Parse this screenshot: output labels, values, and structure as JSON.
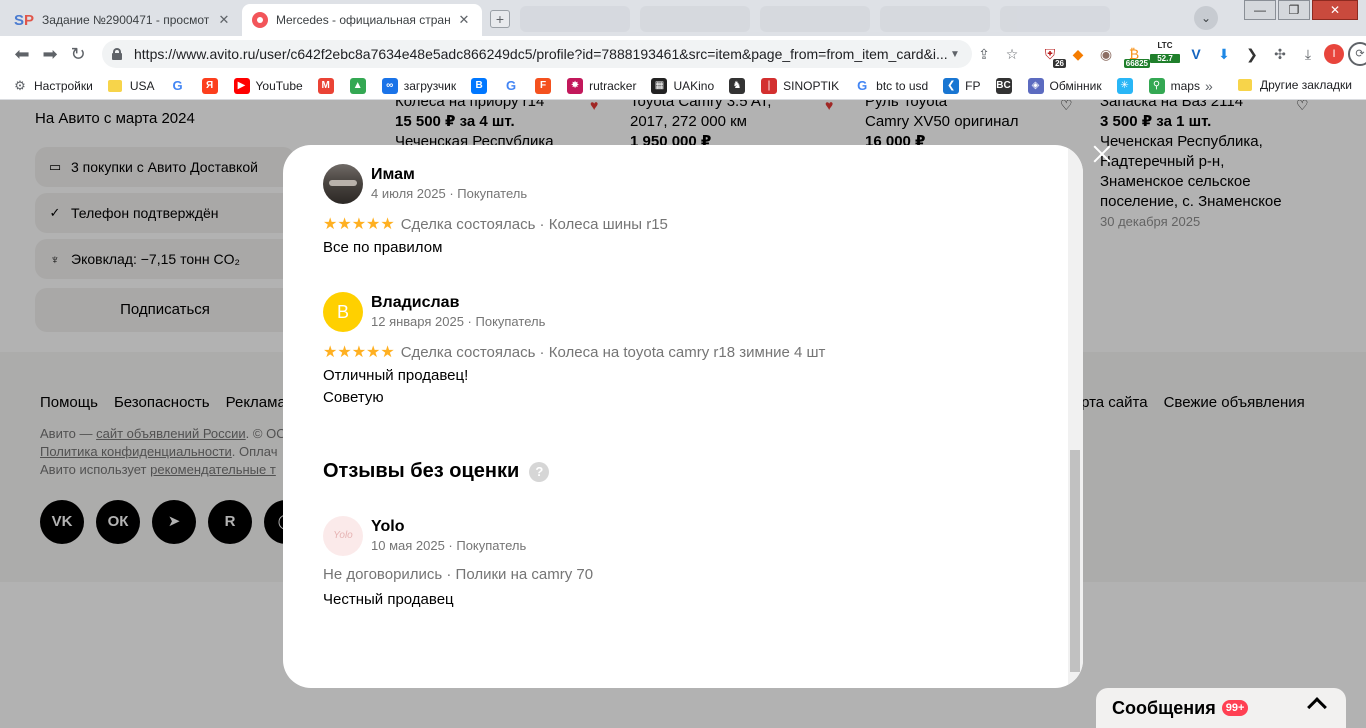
{
  "browser": {
    "tabs": [
      {
        "title": "Задание №2900471 - просмотр з",
        "favicon": "sp-icon"
      },
      {
        "title": "Mercedes - официальная страни",
        "favicon": "avito-icon"
      }
    ],
    "new_tab_label": "+",
    "profile_dropdown": "⌄",
    "window_controls": {
      "minimize": "—",
      "maximize": "❐",
      "close": "✕"
    },
    "url": "https://www.avito.ru/user/c642f2ebc8a7634e48e5adc866249dc5/profile?id=7888193461&src=item&page_from=from_item_card&i...",
    "extensions": {
      "badge_26": "26",
      "ltc_label": "LTC",
      "ltc_value": "52.7",
      "btc_value": "66825",
      "avatar_letter": "I"
    },
    "bookmarks": [
      {
        "label": "Настройки",
        "icon": "gear-icon",
        "color": "#5f6368"
      },
      {
        "label": "USA",
        "icon": "folder-icon",
        "color": "#f7d44a"
      },
      {
        "label": "",
        "icon": "google-icon",
        "color": "#4285f4"
      },
      {
        "label": "",
        "icon": "yandex-icon",
        "color": "#fc3f1d"
      },
      {
        "label": "YouTube",
        "icon": "youtube-icon",
        "color": "#ff0000"
      },
      {
        "label": "",
        "icon": "gmail-icon",
        "color": "#ea4335"
      },
      {
        "label": "",
        "icon": "drive-icon",
        "color": "#34a853"
      },
      {
        "label": "загрузчик",
        "icon": "loader-icon",
        "color": "#1a73e8"
      },
      {
        "label": "",
        "icon": "vk-icon",
        "color": "#0077ff"
      },
      {
        "label": "",
        "icon": "translate-icon",
        "color": "#4285f4"
      },
      {
        "label": "",
        "icon": "f-icon",
        "color": "#f4511e"
      },
      {
        "label": "rutracker",
        "icon": "rutracker-icon",
        "color": "#c2185b"
      },
      {
        "label": "UAKino",
        "icon": "uakino-icon",
        "color": "#222222"
      },
      {
        "label": "",
        "icon": "chess-icon",
        "color": "#333333"
      },
      {
        "label": "SINOPTIK",
        "icon": "thermometer-icon",
        "color": "#d32f2f"
      },
      {
        "label": "btc to usd",
        "icon": "google-icon",
        "color": "#4285f4"
      },
      {
        "label": "FP",
        "icon": "fp-icon",
        "color": "#1976d2"
      },
      {
        "label": "",
        "icon": "bc-icon",
        "color": "#333333"
      },
      {
        "label": "Обмінник",
        "icon": "exchange-icon",
        "color": "#5c6bc0"
      },
      {
        "label": "",
        "icon": "sparkle-icon",
        "color": "#29b6f6"
      },
      {
        "label": "maps",
        "icon": "maps-icon",
        "color": "#34a853"
      }
    ],
    "bookmarks_more": "»",
    "other_bookmarks": "Другие закладки"
  },
  "page": {
    "since": "На Авито с марта 2024",
    "badges": [
      {
        "icon": "delivery-icon",
        "label": "3 покупки с Авито Доставкой"
      },
      {
        "icon": "check-icon",
        "label": "Телефон подтверждён"
      },
      {
        "icon": "eco-icon",
        "label": "Эковклад: −7,15 тонн CO₂"
      }
    ],
    "subscribe": "Подписаться",
    "cards": [
      {
        "line1": "Колеса на приору r14",
        "line2": "15 500 ₽ за 4 шт.",
        "line3": "Чеченская Республика"
      },
      {
        "line1": "Toyota Camry 3.5 AT,",
        "line2": "2017, 272 000 км",
        "line3": "1 950 000 ₽"
      },
      {
        "line1": "Руль Toyota",
        "line2": "Camry XV50 оригинал",
        "line3": "16 000 ₽"
      },
      {
        "line1": "Запаска на Ваз 2114",
        "line2": "3 500 ₽ за 1 шт.",
        "line3": "Чеченская Республика,",
        "line4": "Надтеречный р-н,",
        "line5": "Знаменское сельское",
        "line6": "поселение, с. Знаменское",
        "date": "30 декабря 2025"
      }
    ],
    "footer": {
      "links_left": [
        "Помощь",
        "Безопасность",
        "Реклама"
      ],
      "links_right": [
        "Карта сайта",
        "Свежие объявления"
      ],
      "note1_a": "Авито — ",
      "note1_link": "сайт объявлений России",
      "note1_b": ". © ОО",
      "note2_link": "Политика конфиденциальности",
      "note2_b": ". Оплач",
      "note3_a": "Авито использует ",
      "note3_link": "рекомендательные т",
      "social": [
        "VK",
        "ОК",
        "➤",
        "R",
        "◯"
      ]
    }
  },
  "modal": {
    "reviews": [
      {
        "name": "Имам",
        "meta": "4 июля 2025 · Покупатель",
        "stars": "★★★★★",
        "deal": "Сделка состоялась · Колеса шины r15",
        "text": [
          "Все по правилом"
        ]
      },
      {
        "name": "Владислав",
        "avatar_letter": "В",
        "meta": "12 января 2025 · Покупатель",
        "stars": "★★★★★",
        "deal": "Сделка состоялась · Колеса на toyota camry r18 зимние 4 шт",
        "text": [
          "Отличный продавец!",
          "Советую"
        ]
      }
    ],
    "no_rating_title": "Отзывы без оценки",
    "help_label": "?",
    "unrated": {
      "name": "Yolo",
      "avatar_text": "Yolo",
      "meta": "10 мая 2025 · Покупатель",
      "deal": "Не договорились · Полики на camry 70",
      "text": "Честный продавец"
    }
  },
  "messages": {
    "label": "Сообщения",
    "badge": "99+"
  }
}
